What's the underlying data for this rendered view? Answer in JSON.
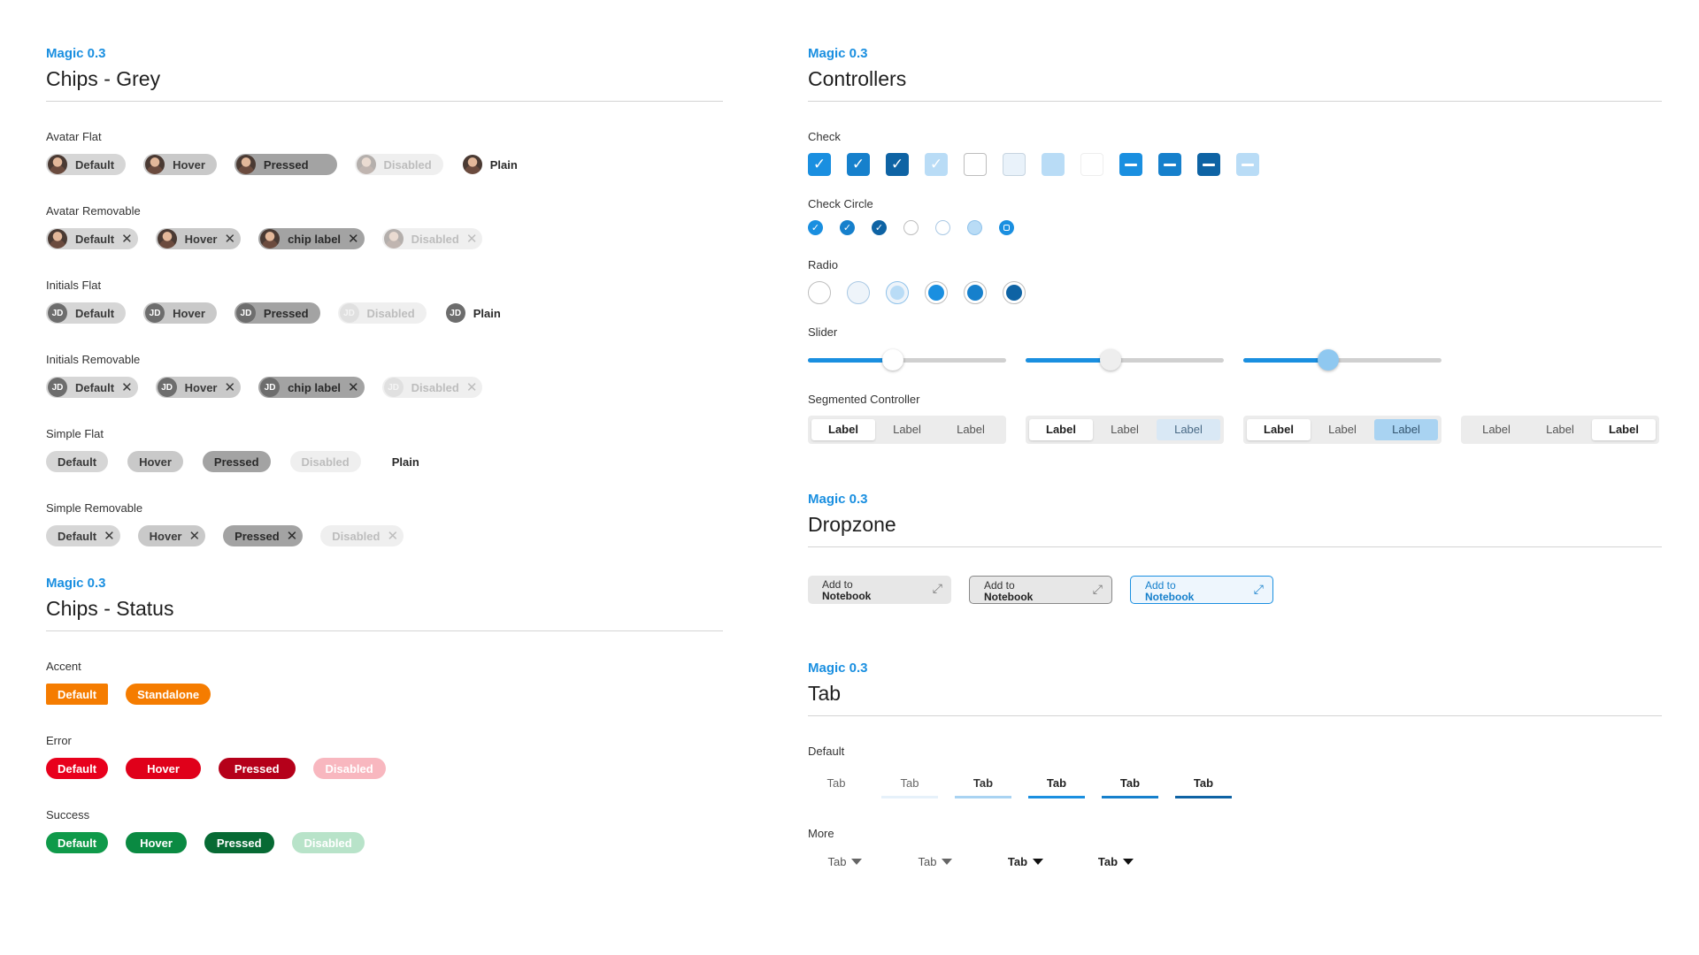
{
  "grey": {
    "eyebrow": "Magic 0.3",
    "title": "Chips - Grey",
    "avatar_flat": {
      "label": "Avatar Flat",
      "chips": [
        "Default",
        "Hover",
        "Pressed",
        "Disabled",
        "Plain"
      ]
    },
    "avatar_removable": {
      "label": "Avatar Removable",
      "chips": [
        "Default",
        "Hover",
        "chip label",
        "Disabled"
      ]
    },
    "initials_flat": {
      "label": "Initials Flat",
      "initials": "JD",
      "chips": [
        "Default",
        "Hover",
        "Pressed",
        "Disabled",
        "Plain"
      ]
    },
    "initials_removable": {
      "label": "Initials Removable",
      "initials": "JD",
      "chips": [
        "Default",
        "Hover",
        "chip label",
        "Disabled"
      ]
    },
    "simple_flat": {
      "label": "Simple Flat",
      "chips": [
        "Default",
        "Hover",
        "Pressed",
        "Disabled",
        "Plain"
      ]
    },
    "simple_removable": {
      "label": "Simple Removable",
      "chips": [
        "Default",
        "Hover",
        "Pressed",
        "Disabled"
      ]
    }
  },
  "status": {
    "eyebrow": "Magic 0.3",
    "title": "Chips - Status",
    "accent": {
      "label": "Accent",
      "chips": [
        "Default",
        "Standalone"
      ]
    },
    "error": {
      "label": "Error",
      "chips": [
        "Default",
        "Hover",
        "Pressed",
        "Disabled"
      ]
    },
    "success": {
      "label": "Success",
      "chips": [
        "Default",
        "Hover",
        "Pressed",
        "Disabled"
      ]
    }
  },
  "controllers": {
    "eyebrow": "Magic 0.3",
    "title": "Controllers",
    "check_label": "Check",
    "check_circle_label": "Check Circle",
    "radio_label": "Radio",
    "slider_label": "Slider",
    "sliders": [
      0.43,
      0.43,
      0.43
    ],
    "segmented_label": "Segmented Controller",
    "segments": [
      "Label",
      "Label",
      "Label"
    ]
  },
  "dropzone": {
    "eyebrow": "Magic 0.3",
    "title": "Dropzone",
    "line1": "Add to",
    "line2": "Notebook"
  },
  "tab": {
    "eyebrow": "Magic 0.3",
    "title": "Tab",
    "default_label": "Default",
    "more_label": "More",
    "tab_text": "Tab"
  },
  "icons": {
    "check": "✓",
    "close": "✕",
    "expand": "⤢"
  },
  "colors": {
    "accent_blue": "#1a8fe0",
    "accent_orange": "#f57c00",
    "error_red": "#e8001c",
    "success_green": "#0f9a4a"
  }
}
